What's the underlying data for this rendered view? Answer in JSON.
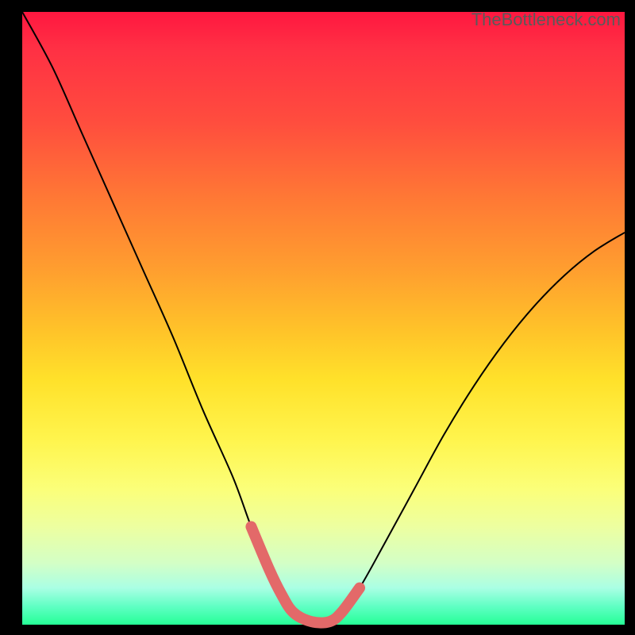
{
  "watermark": "TheBottleneck.com",
  "chart_data": {
    "type": "line",
    "title": "",
    "xlabel": "",
    "ylabel": "",
    "xlim": [
      0,
      100
    ],
    "ylim": [
      0,
      100
    ],
    "grid": false,
    "series": [
      {
        "name": "curve",
        "x": [
          0,
          5,
          10,
          15,
          20,
          25,
          30,
          35,
          38,
          41,
          43,
          45,
          48,
          51,
          53,
          56,
          60,
          65,
          70,
          75,
          80,
          85,
          90,
          95,
          100
        ],
        "y": [
          100,
          91,
          80,
          69,
          58,
          47,
          35,
          24,
          16,
          9,
          5,
          2,
          0.5,
          0.5,
          2,
          6,
          13,
          22,
          31,
          39,
          46,
          52,
          57,
          61,
          64
        ]
      }
    ],
    "highlight_range_x": [
      38,
      56
    ],
    "gradient_direction": "vertical_top_to_bottom",
    "gradient_meaning": "background encodes y-value from high (red, top) to low (green, bottom)"
  }
}
